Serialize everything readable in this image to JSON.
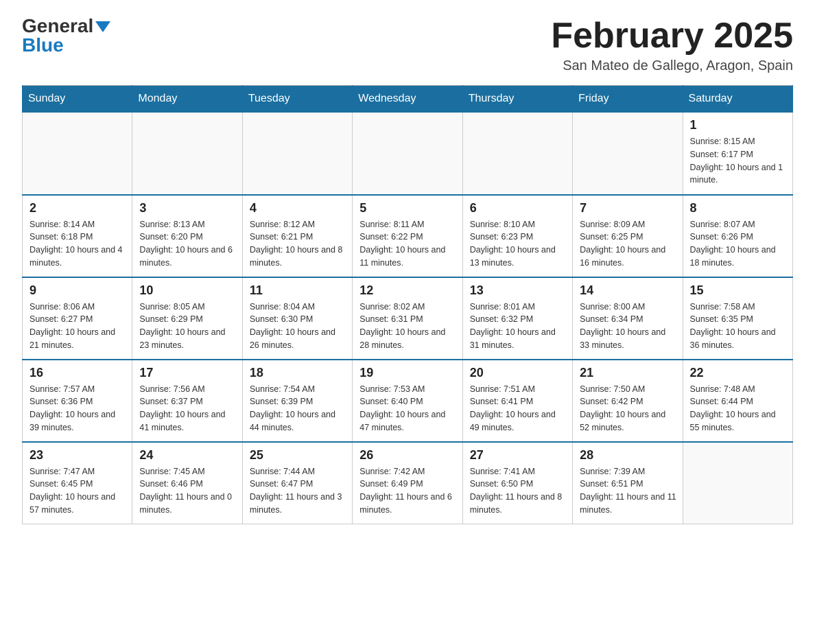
{
  "logo": {
    "general": "General",
    "blue": "Blue"
  },
  "title": "February 2025",
  "subtitle": "San Mateo de Gallego, Aragon, Spain",
  "days": [
    "Sunday",
    "Monday",
    "Tuesday",
    "Wednesday",
    "Thursday",
    "Friday",
    "Saturday"
  ],
  "weeks": [
    [
      {
        "day": "",
        "info": ""
      },
      {
        "day": "",
        "info": ""
      },
      {
        "day": "",
        "info": ""
      },
      {
        "day": "",
        "info": ""
      },
      {
        "day": "",
        "info": ""
      },
      {
        "day": "",
        "info": ""
      },
      {
        "day": "1",
        "info": "Sunrise: 8:15 AM\nSunset: 6:17 PM\nDaylight: 10 hours and 1 minute."
      }
    ],
    [
      {
        "day": "2",
        "info": "Sunrise: 8:14 AM\nSunset: 6:18 PM\nDaylight: 10 hours and 4 minutes."
      },
      {
        "day": "3",
        "info": "Sunrise: 8:13 AM\nSunset: 6:20 PM\nDaylight: 10 hours and 6 minutes."
      },
      {
        "day": "4",
        "info": "Sunrise: 8:12 AM\nSunset: 6:21 PM\nDaylight: 10 hours and 8 minutes."
      },
      {
        "day": "5",
        "info": "Sunrise: 8:11 AM\nSunset: 6:22 PM\nDaylight: 10 hours and 11 minutes."
      },
      {
        "day": "6",
        "info": "Sunrise: 8:10 AM\nSunset: 6:23 PM\nDaylight: 10 hours and 13 minutes."
      },
      {
        "day": "7",
        "info": "Sunrise: 8:09 AM\nSunset: 6:25 PM\nDaylight: 10 hours and 16 minutes."
      },
      {
        "day": "8",
        "info": "Sunrise: 8:07 AM\nSunset: 6:26 PM\nDaylight: 10 hours and 18 minutes."
      }
    ],
    [
      {
        "day": "9",
        "info": "Sunrise: 8:06 AM\nSunset: 6:27 PM\nDaylight: 10 hours and 21 minutes."
      },
      {
        "day": "10",
        "info": "Sunrise: 8:05 AM\nSunset: 6:29 PM\nDaylight: 10 hours and 23 minutes."
      },
      {
        "day": "11",
        "info": "Sunrise: 8:04 AM\nSunset: 6:30 PM\nDaylight: 10 hours and 26 minutes."
      },
      {
        "day": "12",
        "info": "Sunrise: 8:02 AM\nSunset: 6:31 PM\nDaylight: 10 hours and 28 minutes."
      },
      {
        "day": "13",
        "info": "Sunrise: 8:01 AM\nSunset: 6:32 PM\nDaylight: 10 hours and 31 minutes."
      },
      {
        "day": "14",
        "info": "Sunrise: 8:00 AM\nSunset: 6:34 PM\nDaylight: 10 hours and 33 minutes."
      },
      {
        "day": "15",
        "info": "Sunrise: 7:58 AM\nSunset: 6:35 PM\nDaylight: 10 hours and 36 minutes."
      }
    ],
    [
      {
        "day": "16",
        "info": "Sunrise: 7:57 AM\nSunset: 6:36 PM\nDaylight: 10 hours and 39 minutes."
      },
      {
        "day": "17",
        "info": "Sunrise: 7:56 AM\nSunset: 6:37 PM\nDaylight: 10 hours and 41 minutes."
      },
      {
        "day": "18",
        "info": "Sunrise: 7:54 AM\nSunset: 6:39 PM\nDaylight: 10 hours and 44 minutes."
      },
      {
        "day": "19",
        "info": "Sunrise: 7:53 AM\nSunset: 6:40 PM\nDaylight: 10 hours and 47 minutes."
      },
      {
        "day": "20",
        "info": "Sunrise: 7:51 AM\nSunset: 6:41 PM\nDaylight: 10 hours and 49 minutes."
      },
      {
        "day": "21",
        "info": "Sunrise: 7:50 AM\nSunset: 6:42 PM\nDaylight: 10 hours and 52 minutes."
      },
      {
        "day": "22",
        "info": "Sunrise: 7:48 AM\nSunset: 6:44 PM\nDaylight: 10 hours and 55 minutes."
      }
    ],
    [
      {
        "day": "23",
        "info": "Sunrise: 7:47 AM\nSunset: 6:45 PM\nDaylight: 10 hours and 57 minutes."
      },
      {
        "day": "24",
        "info": "Sunrise: 7:45 AM\nSunset: 6:46 PM\nDaylight: 11 hours and 0 minutes."
      },
      {
        "day": "25",
        "info": "Sunrise: 7:44 AM\nSunset: 6:47 PM\nDaylight: 11 hours and 3 minutes."
      },
      {
        "day": "26",
        "info": "Sunrise: 7:42 AM\nSunset: 6:49 PM\nDaylight: 11 hours and 6 minutes."
      },
      {
        "day": "27",
        "info": "Sunrise: 7:41 AM\nSunset: 6:50 PM\nDaylight: 11 hours and 8 minutes."
      },
      {
        "day": "28",
        "info": "Sunrise: 7:39 AM\nSunset: 6:51 PM\nDaylight: 11 hours and 11 minutes."
      },
      {
        "day": "",
        "info": ""
      }
    ]
  ]
}
